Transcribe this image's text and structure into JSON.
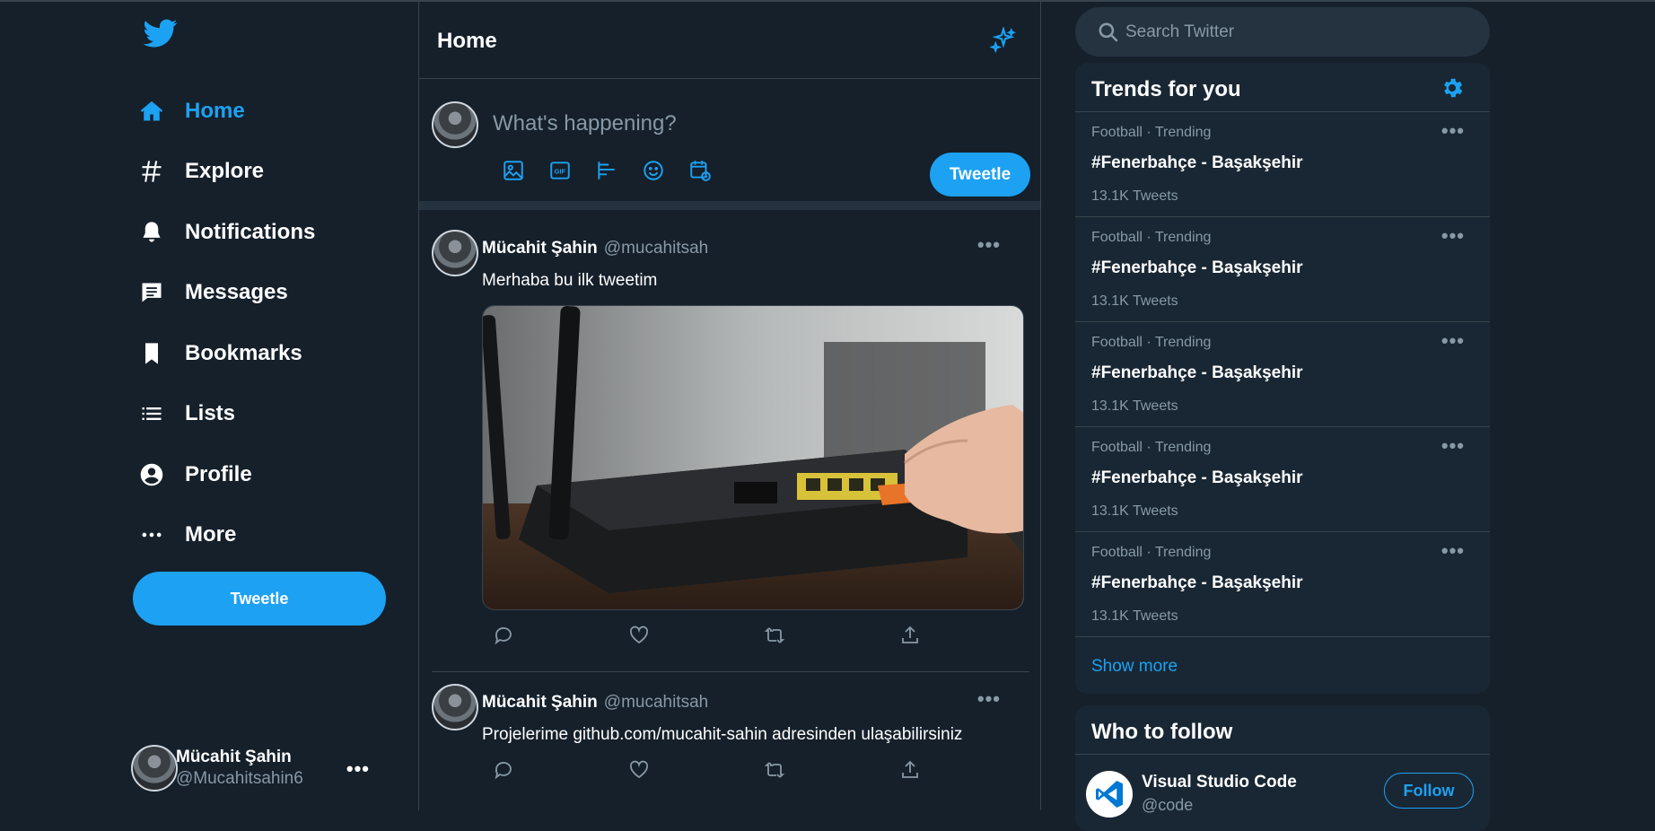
{
  "colors": {
    "background": "#15202b",
    "panel": "#192734",
    "accent": "#1da1f2",
    "muted": "#8899a6",
    "border": "#38444d"
  },
  "sidebar": {
    "logo_icon": "twitter-bird-icon",
    "items": [
      {
        "label": "Home",
        "icon": "home-icon",
        "active": true
      },
      {
        "label": "Explore",
        "icon": "hashtag-icon"
      },
      {
        "label": "Notifications",
        "icon": "bell-icon"
      },
      {
        "label": "Messages",
        "icon": "message-icon"
      },
      {
        "label": "Bookmarks",
        "icon": "bookmark-icon"
      },
      {
        "label": "Lists",
        "icon": "list-icon"
      },
      {
        "label": "Profile",
        "icon": "user-icon"
      },
      {
        "label": "More",
        "icon": "more-dots-icon"
      }
    ],
    "tweet_button": "Tweetle",
    "profile": {
      "name": "Mücahit Şahin",
      "handle": "@Mucahitsahin6",
      "more": "•••"
    }
  },
  "main": {
    "title": "Home",
    "composer": {
      "placeholder": "What's happening?",
      "tweet_button": "Tweetle",
      "tools": [
        "image-icon",
        "gif-icon",
        "poll-icon",
        "emoji-icon",
        "schedule-icon"
      ]
    },
    "tweets": [
      {
        "name": "Mücahit Şahin",
        "handle": "@mucahitsah",
        "text": "Merhaba bu ilk tweetim",
        "more": "•••",
        "has_media": true
      },
      {
        "name": "Mücahit Şahin",
        "handle": "@mucahitsah",
        "text": "Projelerime github.com/mucahit-sahin adresinden ulaşabilirsiniz",
        "more": "•••",
        "has_media": false
      }
    ]
  },
  "right": {
    "search": {
      "placeholder": "Search Twitter"
    },
    "trends": {
      "title": "Trends for you",
      "items": [
        {
          "meta": "Football · Trending",
          "title": "#Fenerbahçe - Başakşehir",
          "count": "13.1K Tweets",
          "more": "•••"
        },
        {
          "meta": "Football · Trending",
          "title": "#Fenerbahçe - Başakşehir",
          "count": "13.1K Tweets",
          "more": "•••"
        },
        {
          "meta": "Football · Trending",
          "title": "#Fenerbahçe - Başakşehir",
          "count": "13.1K Tweets",
          "more": "•••"
        },
        {
          "meta": "Football · Trending",
          "title": "#Fenerbahçe - Başakşehir",
          "count": "13.1K Tweets",
          "more": "•••"
        },
        {
          "meta": "Football · Trending",
          "title": "#Fenerbahçe - Başakşehir",
          "count": "13.1K Tweets",
          "more": "•••"
        }
      ],
      "show_more": "Show more"
    },
    "who_to_follow": {
      "title": "Who to follow",
      "accounts": [
        {
          "name": "Visual Studio Code",
          "handle": "@code",
          "button": "Follow"
        }
      ]
    }
  }
}
